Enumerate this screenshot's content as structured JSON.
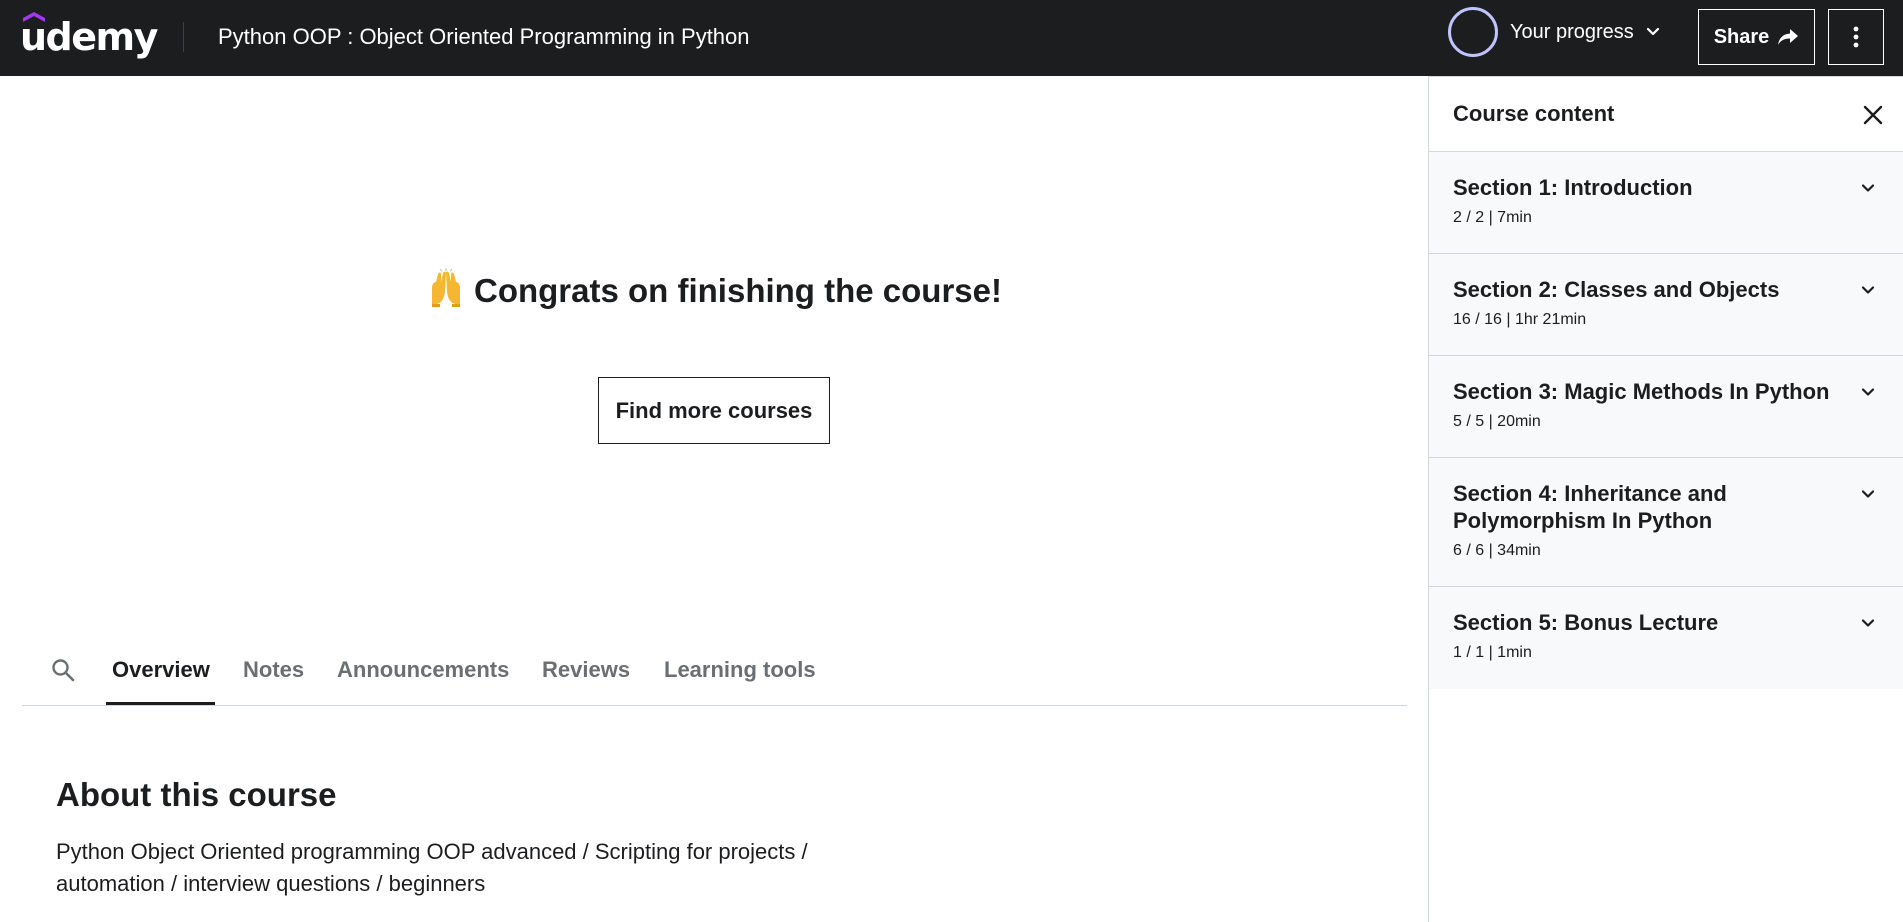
{
  "header": {
    "logo_text": "udemy",
    "course_title": "Python OOP : Object Oriented Programming in Python",
    "progress_label": "Your progress",
    "share_label": "Share"
  },
  "main": {
    "congrats_text": "Congrats on finishing the course!",
    "find_courses_label": "Find more courses",
    "tabs": [
      {
        "label": "Overview"
      },
      {
        "label": "Notes"
      },
      {
        "label": "Announcements"
      },
      {
        "label": "Reviews"
      },
      {
        "label": "Learning tools"
      }
    ],
    "active_tab": "Overview",
    "about_title": "About this course",
    "about_text_line1": "Python Object Oriented programming OOP advanced / Scripting for projects /",
    "about_text_line2": "automation / interview questions / beginners"
  },
  "sidebar": {
    "title": "Course content",
    "sections": [
      {
        "title": "Section 1: Introduction",
        "meta": "2 / 2 | 7min"
      },
      {
        "title": "Section 2: Classes and Objects",
        "meta": "16 / 16 | 1hr 21min"
      },
      {
        "title": "Section 3: Magic Methods In Python",
        "meta": "5 / 5 | 20min"
      },
      {
        "title_line1": "Section 4: Inheritance and",
        "title_line2": "Polymorphism In Python",
        "meta": "6 / 6 | 34min"
      },
      {
        "title": "Section 5: Bonus Lecture",
        "meta": "1 / 1 | 1min"
      }
    ]
  },
  "colors": {
    "header_bg": "#1c1d1f",
    "brand_purple": "#a435f0",
    "progress_ring": "#c0c4fc",
    "sidebar_section_bg": "#f7f9fa"
  }
}
